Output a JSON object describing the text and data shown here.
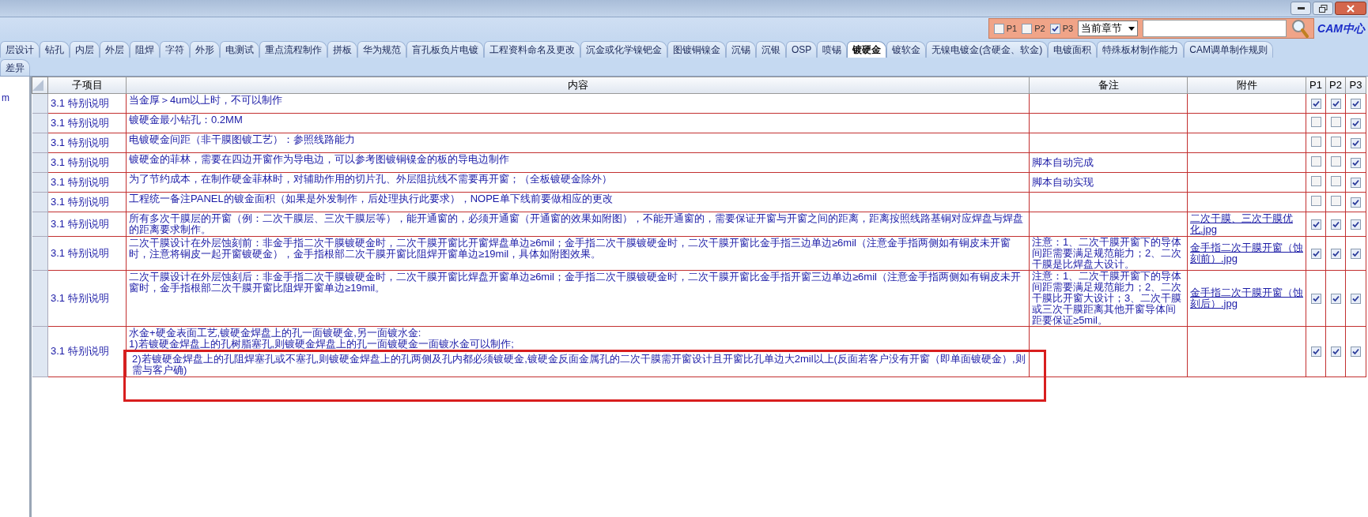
{
  "toolbar": {
    "filters": [
      {
        "label": "P1",
        "checked": false
      },
      {
        "label": "P2",
        "checked": false
      },
      {
        "label": "P3",
        "checked": true
      }
    ],
    "chapter_select": {
      "value": "当前章节"
    },
    "logo": {
      "text": "CAM中心"
    }
  },
  "tab_rows": [
    [
      {
        "label": "层设计",
        "selected": false
      },
      {
        "label": "钻孔",
        "selected": false
      },
      {
        "label": "内层",
        "selected": false
      },
      {
        "label": "外层",
        "selected": false
      },
      {
        "label": "阻焊",
        "selected": false
      },
      {
        "label": "字符",
        "selected": false
      },
      {
        "label": "外形",
        "selected": false
      },
      {
        "label": "电测试",
        "selected": false
      },
      {
        "label": "重点流程制作",
        "selected": false
      },
      {
        "label": "拼板",
        "selected": false
      },
      {
        "label": "华为规范",
        "selected": false
      },
      {
        "label": "盲孔板负片电镀",
        "selected": false
      },
      {
        "label": "工程资料命名及更改",
        "selected": false
      },
      {
        "label": "沉金或化学镍钯金",
        "selected": false
      },
      {
        "label": "图镀铜镍金",
        "selected": false
      },
      {
        "label": "沉锡",
        "selected": false
      },
      {
        "label": "沉银",
        "selected": false
      },
      {
        "label": "OSP",
        "selected": false
      },
      {
        "label": "喷锡",
        "selected": false
      },
      {
        "label": "镀硬金",
        "selected": true
      },
      {
        "label": "镀软金",
        "selected": false
      },
      {
        "label": "无镍电镀金(含硬金、软金)",
        "selected": false
      },
      {
        "label": "电镀面积",
        "selected": false
      },
      {
        "label": "特殊板材制作能力",
        "selected": false
      },
      {
        "label": "CAM调单制作规则",
        "selected": false
      }
    ],
    [
      {
        "label": "差异",
        "selected": false
      }
    ]
  ],
  "left_panel": {
    "text": "m"
  },
  "table": {
    "columns": [
      "子项目",
      "内容",
      "备注",
      "附件",
      "P1",
      "P2",
      "P3"
    ],
    "rows": [
      {
        "sub_item": "3.1 特别说明",
        "content": [
          "当金厚＞4um以上时，不可以制作"
        ],
        "p1": true,
        "p2": true,
        "p3": true,
        "highlighted": false
      },
      {
        "sub_item": "3.1 特别说明",
        "content": [
          "镀硬金最小钻孔：0.2MM"
        ],
        "p1": false,
        "p2": false,
        "p3": true,
        "highlighted": false
      },
      {
        "sub_item": "3.1 特别说明",
        "content": [
          "电镀硬金间距（非干膜图镀工艺）：参照线路能力"
        ],
        "p1": false,
        "p2": false,
        "p3": true,
        "highlighted": false
      },
      {
        "sub_item": "3.1 特别说明",
        "content": [
          "镀硬金的菲林，需要在四边开窗作为导电边，可以参考图镀铜镍金的板的导电边制作"
        ],
        "note": "脚本自动完成",
        "p1": false,
        "p2": false,
        "p3": true,
        "highlighted": false
      },
      {
        "sub_item": "3.1 特别说明",
        "content": [
          "为了节约成本，在制作硬金菲林时，对辅助作用的切片孔、外层阻抗线不需要再开窗；（全板镀硬金除外）"
        ],
        "note": "脚本自动实现",
        "p1": false,
        "p2": false,
        "p3": true,
        "highlighted": false
      },
      {
        "sub_item": "3.1 特别说明",
        "content": [
          "工程统一备注PANEL的镀金面积（如果是外发制作，后处理执行此要求），NOPE单下线前要做相应的更改"
        ],
        "p1": false,
        "p2": false,
        "p3": true,
        "highlighted": false
      },
      {
        "sub_item": "3.1 特别说明",
        "content": [
          "所有多次干膜层的开窗（例：二次干膜层、三次干膜层等），能开通窗的，必须开通窗（开通窗的效果如附图），不能开通窗的，需要保证开窗与开窗之间的距离，距离按照线路基铜对应焊盘与焊盘的距离要求制作。"
        ],
        "attachment": "二次干膜、三次干膜优化.jpg",
        "p1": true,
        "p2": true,
        "p3": true,
        "highlighted": false
      },
      {
        "sub_item": "3.1 特别说明",
        "content": [
          "二次干膜设计在外层蚀刻前：非金手指二次干膜镀硬金时，二次干膜开窗比开窗焊盘单边≥6mil；金手指二次干膜镀硬金时，二次干膜开窗比金手指三边单边≥6mil（注意金手指两侧如有铜皮未开窗时，注意将铜皮一起开窗镀硬金），金手指根部二次干膜开窗比阻焊开窗单边≥19mil，具体如附图效果。"
        ],
        "note": "注意：1、二次干膜开窗下的导体间距需要满足规范能力；2、二次干膜是比焊盘大设计。",
        "attachment": "金手指二次干膜开窗（蚀刻前）.jpg",
        "p1": true,
        "p2": true,
        "p3": true,
        "highlighted": false
      },
      {
        "sub_item": "3.1 特别说明",
        "content": [
          "二次干膜设计在外层蚀刻后：非金手指二次干膜镀硬金时，二次干膜开窗比焊盘开窗单边≥6mil；金手指二次干膜镀硬金时，二次干膜开窗比金手指开窗三边单边≥6mil（注意金手指两侧如有铜皮未开窗时，金手指根部二次干膜开窗比阻焊开窗单边≥19mil。"
        ],
        "note": "注意：1、二次干膜开窗下的导体间距需要满足规范能力；2、二次干膜比开窗大设计；3、二次干膜或三次干膜距离其他开窗导体间距要保证≥5mil。",
        "attachment": "金手指二次干膜开窗（蚀刻后）.jpg",
        "p1": true,
        "p2": true,
        "p3": true,
        "highlighted": false
      },
      {
        "sub_item": "3.1 特别说明",
        "content": [
          "水金+硬金表面工艺,镀硬金焊盘上的孔一面镀硬金,另一面镀水金:",
          "1)若镀硬金焊盘上的孔树脂塞孔,则镀硬金焊盘上的孔一面镀硬金一面镀水金可以制作;",
          "2)若镀硬金焊盘上的孔阻焊塞孔或不塞孔,则镀硬金焊盘上的孔两侧及孔内都必须镀硬金,镀硬金反面金属孔的二次干膜需开窗设计且开窗比孔单边大2mil以上(反面若客户没有开窗（即单面镀硬金）,则需与客户确)"
        ],
        "p1": true,
        "p2": true,
        "p3": true,
        "highlighted": true
      }
    ]
  }
}
